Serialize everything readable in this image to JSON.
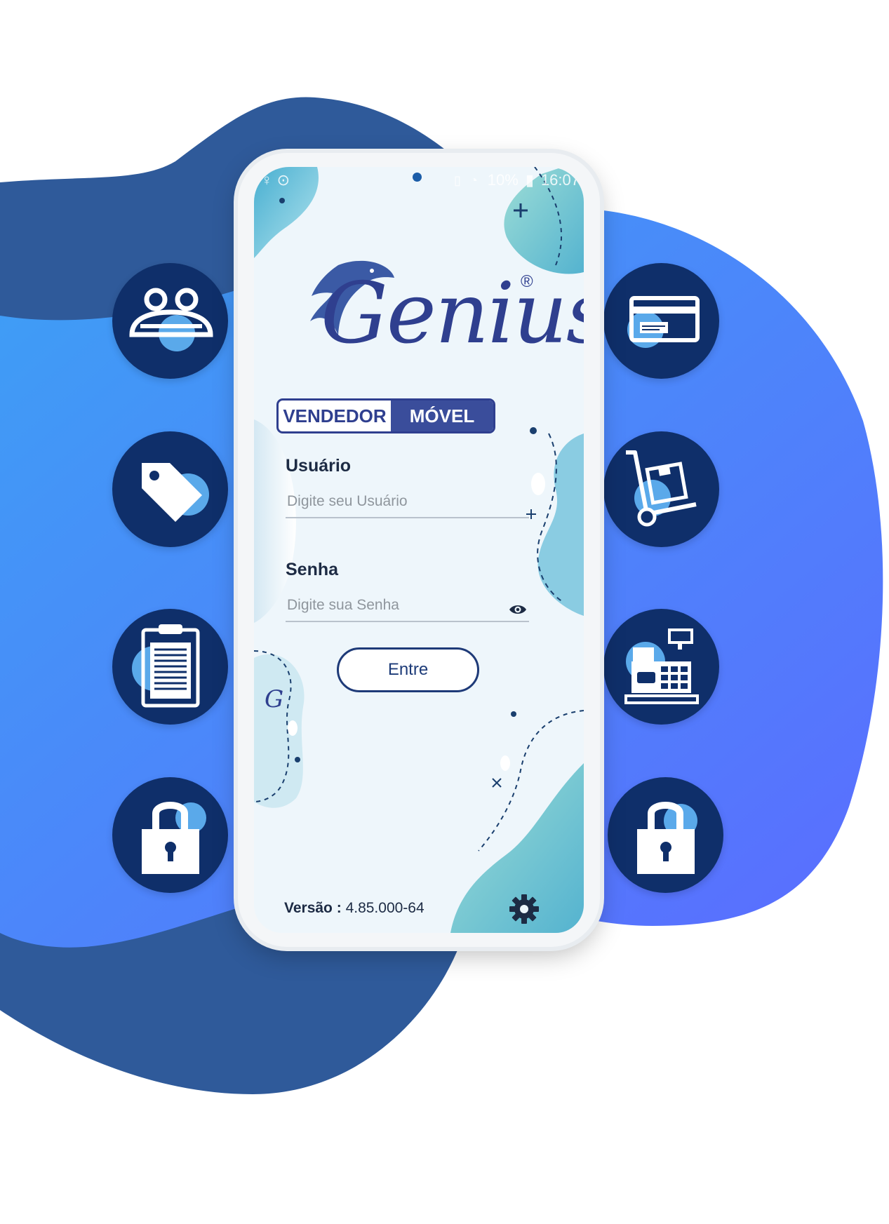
{
  "status_bar": {
    "battery": "10%",
    "time": "16:07"
  },
  "logo": {
    "name": "Genius",
    "registered_mark": "®",
    "badge_left": "VENDEDOR",
    "badge_right": "MÓVEL"
  },
  "login": {
    "user_label": "Usuário",
    "user_placeholder": "Digite seu Usuário",
    "password_label": "Senha",
    "password_placeholder": "Digite sua Senha",
    "submit_label": "Entre"
  },
  "footer": {
    "version_label": "Versão :",
    "version_value": "4.85.000-64"
  },
  "colors": {
    "dark_blob": "#2f5a9a",
    "bright_blob": "#4a88f5",
    "icon_circle": "#0f2f6a",
    "icon_accent": "#5aa9ea"
  },
  "feature_icons": {
    "left": [
      "users-icon",
      "tag-icon",
      "clipboard-icon",
      "lock-icon"
    ],
    "right": [
      "credit-card-icon",
      "hand-truck-icon",
      "cash-register-icon",
      "lock-icon"
    ]
  }
}
